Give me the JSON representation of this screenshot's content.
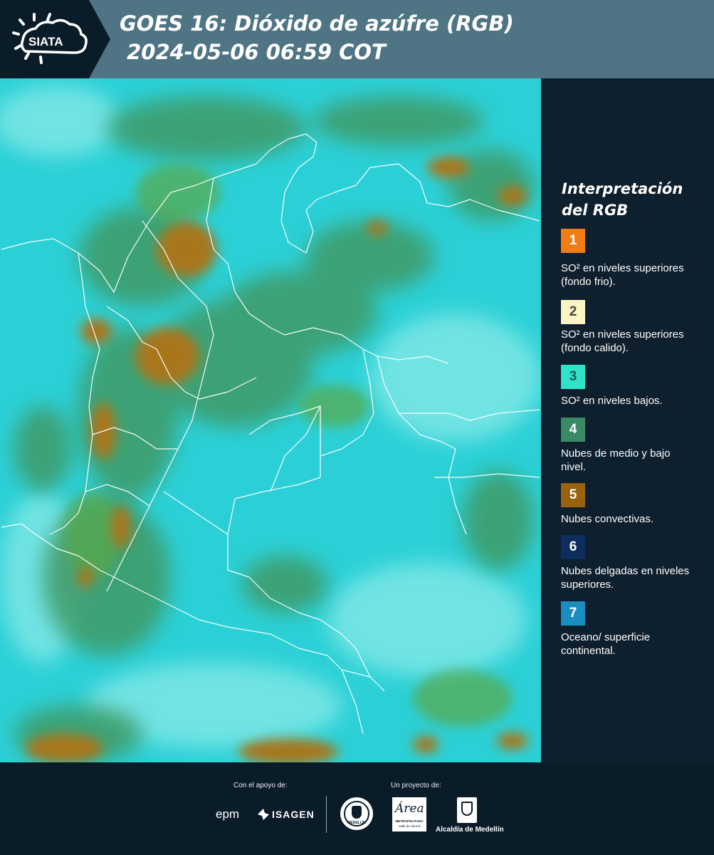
{
  "header": {
    "logo_text": "SIATA",
    "title_line1": "GOES 16: Dióxido de azúfre (RGB)",
    "title_line2": " 2024-05-06 06:59 COT"
  },
  "legend": {
    "title_line1": "Interpretación",
    "title_line2": "del RGB",
    "items": [
      {
        "number": "1",
        "color": "#f07d14",
        "text": "SO² en niveles superiores (fondo frio)."
      },
      {
        "number": "2",
        "color": "#fbf5c3",
        "text": "SO² en niveles superiores (fondo calido)."
      },
      {
        "number": "3",
        "color": "#2fe3c8",
        "text": "SO² en niveles bajos."
      },
      {
        "number": "4",
        "color": "#3a8a67",
        "text": "Nubes de medio y bajo nivel."
      },
      {
        "number": "5",
        "color": "#98620e",
        "text": "Nubes convectivas."
      },
      {
        "number": "6",
        "color": "#0d2d5e",
        "text": "Nubes delgadas en niveles superiores."
      },
      {
        "number": "7",
        "color": "#1a8fbf",
        "text": "Oceano/ superficie continental."
      }
    ]
  },
  "footer": {
    "support_label": "Con el apoyo de:",
    "project_label": "Un proyecto de:",
    "epm": "epm",
    "isagen": "ISAGEN",
    "medellin_seal": "MEDELLÍN",
    "area_script": "Área",
    "area_text_1": "METROPOLITANA",
    "area_text_2": "Valle de Aburrá",
    "alcaldia": "Alcaldía de Medellín"
  }
}
